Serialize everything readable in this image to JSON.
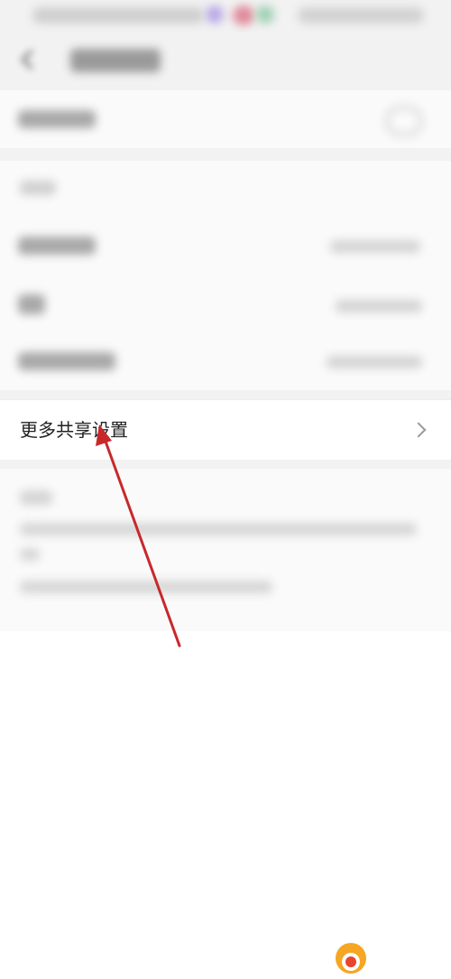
{
  "rows": {
    "more_share_settings": "更多共享设置"
  },
  "colors": {
    "arrow": "#c8282a",
    "watermark_accent": "#e8452c",
    "watermark_circle": "#f5a623"
  },
  "icons": {
    "back": "back-arrow-icon",
    "chevron": "chevron-right-icon"
  }
}
